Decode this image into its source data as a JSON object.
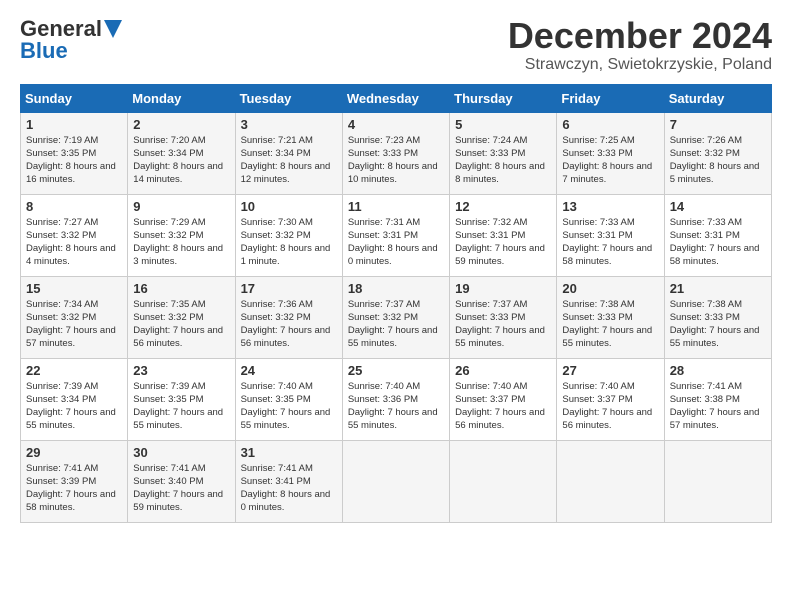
{
  "logo": {
    "line1": "General",
    "line2": "Blue"
  },
  "title": "December 2024",
  "subtitle": "Strawczyn, Swietokrzyskie, Poland",
  "headers": [
    "Sunday",
    "Monday",
    "Tuesday",
    "Wednesday",
    "Thursday",
    "Friday",
    "Saturday"
  ],
  "weeks": [
    [
      {
        "day": "1",
        "info": "Sunrise: 7:19 AM\nSunset: 3:35 PM\nDaylight: 8 hours and 16 minutes."
      },
      {
        "day": "2",
        "info": "Sunrise: 7:20 AM\nSunset: 3:34 PM\nDaylight: 8 hours and 14 minutes."
      },
      {
        "day": "3",
        "info": "Sunrise: 7:21 AM\nSunset: 3:34 PM\nDaylight: 8 hours and 12 minutes."
      },
      {
        "day": "4",
        "info": "Sunrise: 7:23 AM\nSunset: 3:33 PM\nDaylight: 8 hours and 10 minutes."
      },
      {
        "day": "5",
        "info": "Sunrise: 7:24 AM\nSunset: 3:33 PM\nDaylight: 8 hours and 8 minutes."
      },
      {
        "day": "6",
        "info": "Sunrise: 7:25 AM\nSunset: 3:33 PM\nDaylight: 8 hours and 7 minutes."
      },
      {
        "day": "7",
        "info": "Sunrise: 7:26 AM\nSunset: 3:32 PM\nDaylight: 8 hours and 5 minutes."
      }
    ],
    [
      {
        "day": "8",
        "info": "Sunrise: 7:27 AM\nSunset: 3:32 PM\nDaylight: 8 hours and 4 minutes."
      },
      {
        "day": "9",
        "info": "Sunrise: 7:29 AM\nSunset: 3:32 PM\nDaylight: 8 hours and 3 minutes."
      },
      {
        "day": "10",
        "info": "Sunrise: 7:30 AM\nSunset: 3:32 PM\nDaylight: 8 hours and 1 minute."
      },
      {
        "day": "11",
        "info": "Sunrise: 7:31 AM\nSunset: 3:31 PM\nDaylight: 8 hours and 0 minutes."
      },
      {
        "day": "12",
        "info": "Sunrise: 7:32 AM\nSunset: 3:31 PM\nDaylight: 7 hours and 59 minutes."
      },
      {
        "day": "13",
        "info": "Sunrise: 7:33 AM\nSunset: 3:31 PM\nDaylight: 7 hours and 58 minutes."
      },
      {
        "day": "14",
        "info": "Sunrise: 7:33 AM\nSunset: 3:31 PM\nDaylight: 7 hours and 58 minutes."
      }
    ],
    [
      {
        "day": "15",
        "info": "Sunrise: 7:34 AM\nSunset: 3:32 PM\nDaylight: 7 hours and 57 minutes."
      },
      {
        "day": "16",
        "info": "Sunrise: 7:35 AM\nSunset: 3:32 PM\nDaylight: 7 hours and 56 minutes."
      },
      {
        "day": "17",
        "info": "Sunrise: 7:36 AM\nSunset: 3:32 PM\nDaylight: 7 hours and 56 minutes."
      },
      {
        "day": "18",
        "info": "Sunrise: 7:37 AM\nSunset: 3:32 PM\nDaylight: 7 hours and 55 minutes."
      },
      {
        "day": "19",
        "info": "Sunrise: 7:37 AM\nSunset: 3:33 PM\nDaylight: 7 hours and 55 minutes."
      },
      {
        "day": "20",
        "info": "Sunrise: 7:38 AM\nSunset: 3:33 PM\nDaylight: 7 hours and 55 minutes."
      },
      {
        "day": "21",
        "info": "Sunrise: 7:38 AM\nSunset: 3:33 PM\nDaylight: 7 hours and 55 minutes."
      }
    ],
    [
      {
        "day": "22",
        "info": "Sunrise: 7:39 AM\nSunset: 3:34 PM\nDaylight: 7 hours and 55 minutes."
      },
      {
        "day": "23",
        "info": "Sunrise: 7:39 AM\nSunset: 3:35 PM\nDaylight: 7 hours and 55 minutes."
      },
      {
        "day": "24",
        "info": "Sunrise: 7:40 AM\nSunset: 3:35 PM\nDaylight: 7 hours and 55 minutes."
      },
      {
        "day": "25",
        "info": "Sunrise: 7:40 AM\nSunset: 3:36 PM\nDaylight: 7 hours and 55 minutes."
      },
      {
        "day": "26",
        "info": "Sunrise: 7:40 AM\nSunset: 3:37 PM\nDaylight: 7 hours and 56 minutes."
      },
      {
        "day": "27",
        "info": "Sunrise: 7:40 AM\nSunset: 3:37 PM\nDaylight: 7 hours and 56 minutes."
      },
      {
        "day": "28",
        "info": "Sunrise: 7:41 AM\nSunset: 3:38 PM\nDaylight: 7 hours and 57 minutes."
      }
    ],
    [
      {
        "day": "29",
        "info": "Sunrise: 7:41 AM\nSunset: 3:39 PM\nDaylight: 7 hours and 58 minutes."
      },
      {
        "day": "30",
        "info": "Sunrise: 7:41 AM\nSunset: 3:40 PM\nDaylight: 7 hours and 59 minutes."
      },
      {
        "day": "31",
        "info": "Sunrise: 7:41 AM\nSunset: 3:41 PM\nDaylight: 8 hours and 0 minutes."
      },
      {
        "day": "",
        "info": ""
      },
      {
        "day": "",
        "info": ""
      },
      {
        "day": "",
        "info": ""
      },
      {
        "day": "",
        "info": ""
      }
    ]
  ]
}
